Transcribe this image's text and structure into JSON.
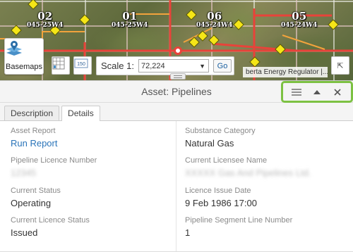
{
  "map": {
    "townships": [
      {
        "num": "02",
        "code": "045-25W4"
      },
      {
        "num": "01",
        "code": "045-25W4"
      },
      {
        "num": "06",
        "code": "045-24W4"
      },
      {
        "num": "05",
        "code": "045-24W4"
      }
    ],
    "basemaps_label": "Basemaps",
    "scale_label": "Scale 1:",
    "scale_value": "72,224",
    "go_label": "Go",
    "attribution": "berta Energy Regulator |...",
    "icons": {
      "basemaps": "basemaps-icon",
      "grid": "grid-icon",
      "scale_ruler": "scale-ruler-icon",
      "collapse": "arrow-collapse-icon",
      "marker": "location-marker-icon"
    },
    "colors": {
      "pipeline_line": "#e8433a",
      "well_symbol": "#f5e617",
      "township_grid": "#ffffff"
    }
  },
  "panel": {
    "title": "Asset: Pipelines",
    "controls": [
      "menu-icon",
      "collapse-up-icon",
      "close-icon"
    ],
    "tabs": [
      {
        "label": "Description",
        "active": false
      },
      {
        "label": "Details",
        "active": true
      }
    ],
    "fields_left": [
      {
        "label": "Asset Report",
        "value": "Run Report",
        "kind": "link"
      },
      {
        "label": "Pipeline Licence Number",
        "value": "12345",
        "kind": "blurred"
      },
      {
        "label": "Current Status",
        "value": "Operating",
        "kind": "text"
      },
      {
        "label": "Current Licence Status",
        "value": "Issued",
        "kind": "text"
      }
    ],
    "fields_right": [
      {
        "label": "Substance Category",
        "value": "Natural Gas",
        "kind": "text"
      },
      {
        "label": "Current Licensee Name",
        "value": "XXXXX Gas And Pipelines Ltd.",
        "kind": "blurred"
      },
      {
        "label": "Licence Issue Date",
        "value": "9 Feb 1986 17:00",
        "kind": "text"
      },
      {
        "label": "Pipeline Segment Line Number",
        "value": "1",
        "kind": "text"
      }
    ],
    "highlight_color": "#7cc142"
  }
}
